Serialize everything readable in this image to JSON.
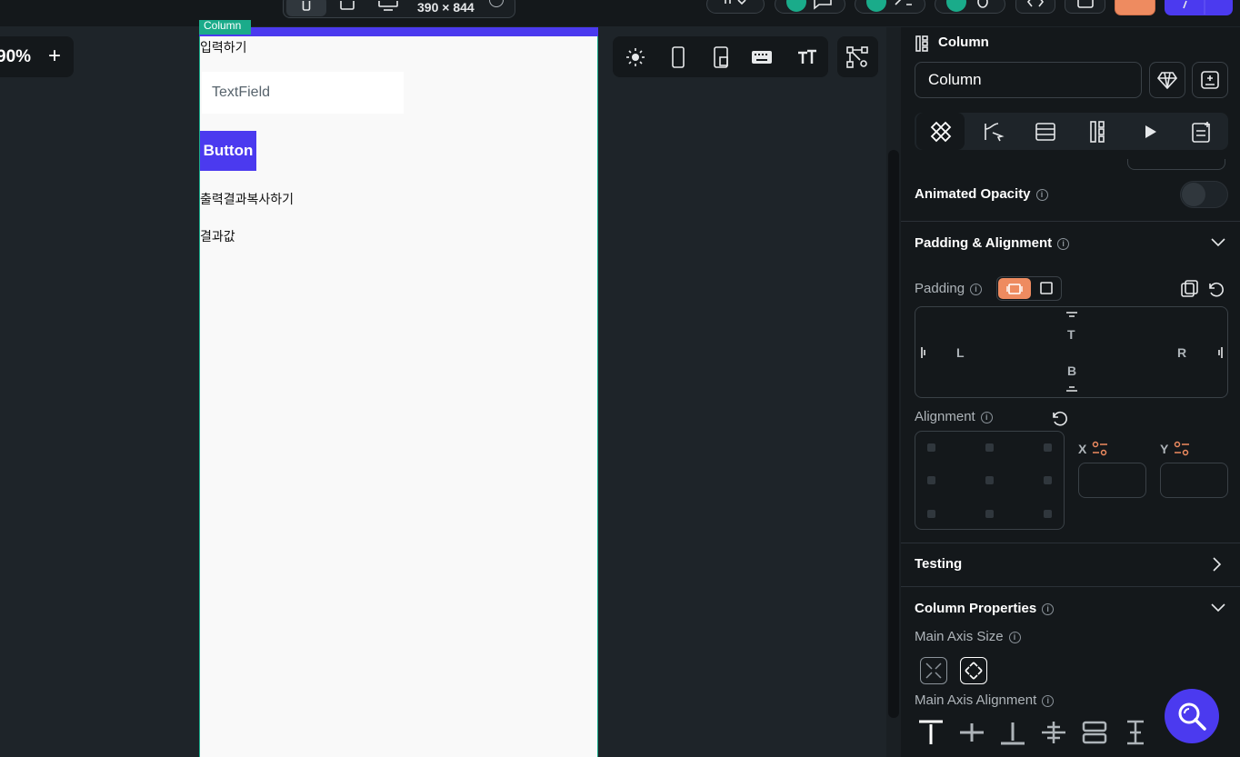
{
  "topbar": {
    "dimensions": "390 × 844",
    "devices": [
      "phone-icon",
      "tablet-icon",
      "desktop-icon"
    ],
    "accent": "#4b3aef"
  },
  "zoom": {
    "value": "90%",
    "plus": "+"
  },
  "canvas": {
    "selection_tag": "Column",
    "input_label": "입력하기",
    "textfield_placeholder": "TextField",
    "button_label": "Button",
    "copy_label": "출력결과복사하기",
    "result_label": "결과값"
  },
  "canvas_toolbar": [
    "sun-icon",
    "phone-icon",
    "tablet-settings-icon",
    "keyboard-icon",
    "text-size-icon",
    "widget-tree-icon"
  ],
  "panel": {
    "header": "Column",
    "name_value": "Column",
    "tabs": [
      "properties-icon",
      "actions-icon",
      "backend-icon",
      "layout-icon",
      "animation-icon",
      "notes-icon"
    ],
    "animated_opacity": "Animated Opacity",
    "padding_alignment": "Padding & Alignment",
    "padding": "Padding",
    "pad_labels": {
      "top": "T",
      "bottom": "B",
      "left": "L",
      "right": "R"
    },
    "alignment": "Alignment",
    "x_label": "X",
    "y_label": "Y",
    "testing": "Testing",
    "column_properties": "Column Properties",
    "main_axis_size": "Main Axis Size",
    "main_axis_alignment": "Main Axis Alignment",
    "accent_orange": "#ee8b60"
  }
}
